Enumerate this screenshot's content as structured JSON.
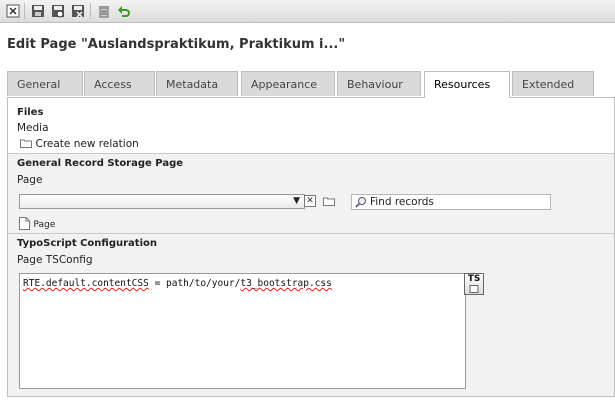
{
  "toolbar": {
    "buttons": [
      {
        "icon": "close-icon"
      },
      {
        "icon": "save-icon"
      },
      {
        "icon": "save-view-icon"
      },
      {
        "icon": "save-close-icon"
      },
      {
        "icon": "delete-icon"
      },
      {
        "icon": "undo-icon"
      }
    ]
  },
  "page_title": "Edit Page \"Auslandspraktikum, Praktikum i...\"",
  "tabs": [
    {
      "label": "General",
      "active": false
    },
    {
      "label": "Access",
      "active": false
    },
    {
      "label": "Metadata",
      "active": false
    },
    {
      "label": "Appearance",
      "active": false
    },
    {
      "label": "Behaviour",
      "active": false
    },
    {
      "label": "Resources",
      "active": true
    },
    {
      "label": "Extended",
      "active": false
    }
  ],
  "files": {
    "title": "Files",
    "media_label": "Media",
    "create_relation": "Create new relation"
  },
  "storage": {
    "title": "General Record Storage Page",
    "page_label": "Page",
    "select_value": "",
    "find_placeholder": "Find records",
    "page_item": "Page"
  },
  "typoscript": {
    "title": "TypoScript Configuration",
    "tsconfig_label": "Page TSConfig",
    "code_prefix": "RTE.default.contentCSS",
    "code_rest": " = path/to/your/",
    "code_file": "t3_bootstrap.css",
    "ts_button": "TS"
  },
  "colors": {
    "accent_red": "#d22",
    "undo_green": "#3a9a22",
    "panel_bg": "#f2f2f2"
  }
}
